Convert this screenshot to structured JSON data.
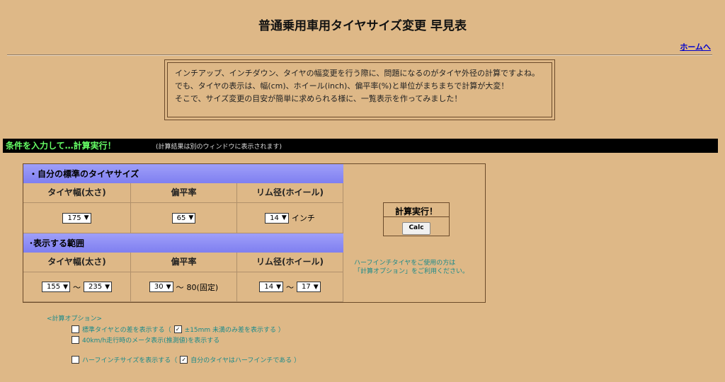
{
  "title": "普通乗用車用タイヤサイズ変更 早見表",
  "home_link": "ホームへ",
  "intro": {
    "line1": "インチアップ、インチダウン、タイヤの幅変更を行う際に、問題になるのがタイヤ外径の計算ですよね。",
    "line2": "でも、タイヤの表示は、幅(cm)、ホイール(inch)、偏平率(%)と単位がまちまちで計算が大変！",
    "line3": "そこで、サイズ変更の目安が簡単に求められる様に、一覧表示を作ってみました！"
  },
  "bar": {
    "title": "条件を入力して…計算実行！",
    "note": "(計算結果は別のウィンドウに表示されます)"
  },
  "standard": {
    "header": "・自分の標準のタイヤサイズ",
    "col_width": "タイヤ幅(太さ)",
    "col_aspect": "偏平率",
    "col_rim": "リム径(ホイール)",
    "width_value": "175",
    "aspect_value": "65",
    "rim_value": "14",
    "rim_unit": "インチ"
  },
  "range": {
    "header": "･表示する範囲",
    "col_width": "タイヤ幅(太さ)",
    "col_aspect": "偏平率",
    "col_rim": "リム径(ホイール)",
    "width_from": "155",
    "width_to": "235",
    "aspect_from": "30",
    "aspect_to_text": "80(固定)",
    "rim_from": "14",
    "rim_to": "17",
    "tilde": "〜"
  },
  "calc": {
    "label": "計算実行！",
    "button": "Calc"
  },
  "half_note": {
    "line1": "ハーフインチタイヤをご使用の方は",
    "line2": "「計算オプション」をご利用ください。"
  },
  "options": {
    "heading": "<計算オプション>",
    "opt1_label": "標準タイヤとの差を表示する（",
    "opt1_sub_label": "±15mm 未満のみ差を表示する ）",
    "opt2_label": "40km/h走行時のメータ表示(推測値)を表示する",
    "opt3_label": "ハーフインチサイズを表示する（",
    "opt3_sub_label": "自分のタイヤはハーフインチである ）",
    "opt1_checked": false,
    "opt1_sub_checked": true,
    "opt2_checked": false,
    "opt3_checked": false,
    "opt3_sub_checked": true
  }
}
